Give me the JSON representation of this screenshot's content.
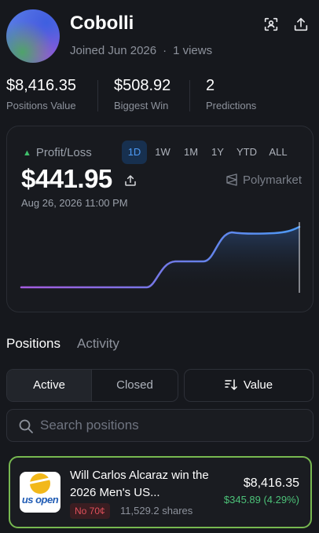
{
  "profile": {
    "username": "Cobolli",
    "joined": "Joined Jun 2026",
    "separator": "·",
    "views": "1 views",
    "icons": [
      "scan-icon",
      "share-icon"
    ]
  },
  "stats": [
    {
      "value": "$8,416.35",
      "label": "Positions Value"
    },
    {
      "value": "$508.92",
      "label": "Biggest Win"
    },
    {
      "value": "2",
      "label": "Predictions"
    }
  ],
  "pnl": {
    "label": "Profit/Loss",
    "trend_icon": "triangle-up-icon",
    "value": "$441.95",
    "date": "Aug 26, 2026 11:00 PM",
    "source": "Polymarket",
    "ranges": [
      "1D",
      "1W",
      "1M",
      "1Y",
      "YTD",
      "ALL"
    ],
    "active_range": "1D",
    "colors": {
      "accent": "#4d9af5",
      "line_start": "#a55ce0",
      "line_end": "#4d9af5",
      "up": "#3fbf6b"
    }
  },
  "tabs": {
    "positions": "Positions",
    "activity": "Activity"
  },
  "filters": {
    "active": "Active",
    "closed": "Closed",
    "sort": "Value"
  },
  "search": {
    "placeholder": "Search positions"
  },
  "position": {
    "logo_text": "us open",
    "title": "Will Carlos Alcaraz win the 2026 Men's US...",
    "badge": "No 70¢",
    "shares": "11,529.2 shares",
    "value": "$8,416.35",
    "pnl": "$345.89 (4.29%)",
    "highlight_color": "#77b850"
  }
}
